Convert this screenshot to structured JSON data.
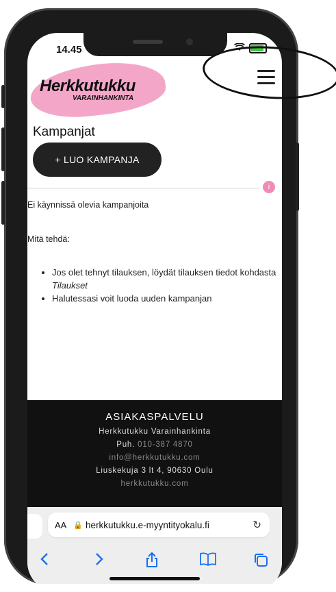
{
  "status_bar": {
    "time": "14.45"
  },
  "header": {
    "logo_text": "Herkkutukku",
    "logo_subtext": "VARAINHANKINTA",
    "menu_icon": "hamburger-menu-icon"
  },
  "main": {
    "title": "Kampanjat",
    "create_button_label": "+ LUO KAMPANJA",
    "info_badge": "i",
    "empty_message": "Ei käynnissä olevia kampanjoita",
    "what_to_do_title": "Mitä tehdä:",
    "tips": {
      "tip1_text": "Jos olet tehnyt tilauksen, löydät tilauksen tiedot kohdasta ",
      "tip1_link": "Tilaukset",
      "tip2_text": "Halutessasi voit luoda uuden kampanjan"
    }
  },
  "footer": {
    "title": "ASIAKASPALVELU",
    "company": "Herkkutukku Varainhankinta",
    "phone_label": "Puh.",
    "phone": "010-387 4870",
    "email": "info@herkkutukku.com",
    "address": "Liuskekuja 3 lt 4, 90630 Oulu",
    "website": "herkkutukku.com"
  },
  "browser": {
    "aa_label": "AA",
    "url": "herkkutukku.e-myyntityokalu.fi",
    "toolbar_icons": [
      "back-icon",
      "forward-icon",
      "share-icon",
      "bookmarks-icon",
      "tabs-icon"
    ]
  },
  "colors": {
    "accent_pink": "#f4a6c8",
    "button_dark": "#222222",
    "link_blue": "#1a6ff0"
  }
}
